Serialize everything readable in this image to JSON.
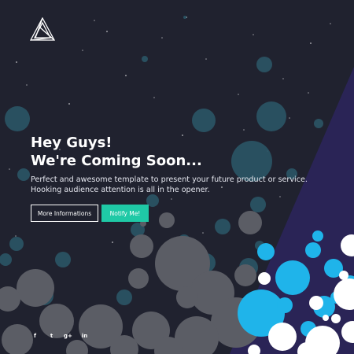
{
  "brand": {
    "logo_icon": "impossible-triangle-icon"
  },
  "hero": {
    "headline_line1": "Hey Guys!",
    "headline_line2": "We're Coming Soon...",
    "lead_line1": "Perfect and awesome template to present your future product or service.",
    "lead_line2": "Hooking audience attention is all in the opener."
  },
  "buttons": {
    "more_info_label": "More Informations",
    "notify_label": "Notify Me!"
  },
  "social": [
    {
      "name": "facebook-icon",
      "glyph": "f"
    },
    {
      "name": "twitter-icon",
      "glyph": "t"
    },
    {
      "name": "google-plus-icon",
      "glyph": "g+"
    },
    {
      "name": "linkedin-icon",
      "glyph": "in"
    }
  ],
  "colors": {
    "background": "#20222f",
    "wedge": "#2a2456",
    "accent_teal": "#1fc9a6",
    "bubble_blue": "#1fb4ea",
    "bubble_gray": "#5b5d65",
    "bubble_dark_teal": "#2b5566"
  }
}
